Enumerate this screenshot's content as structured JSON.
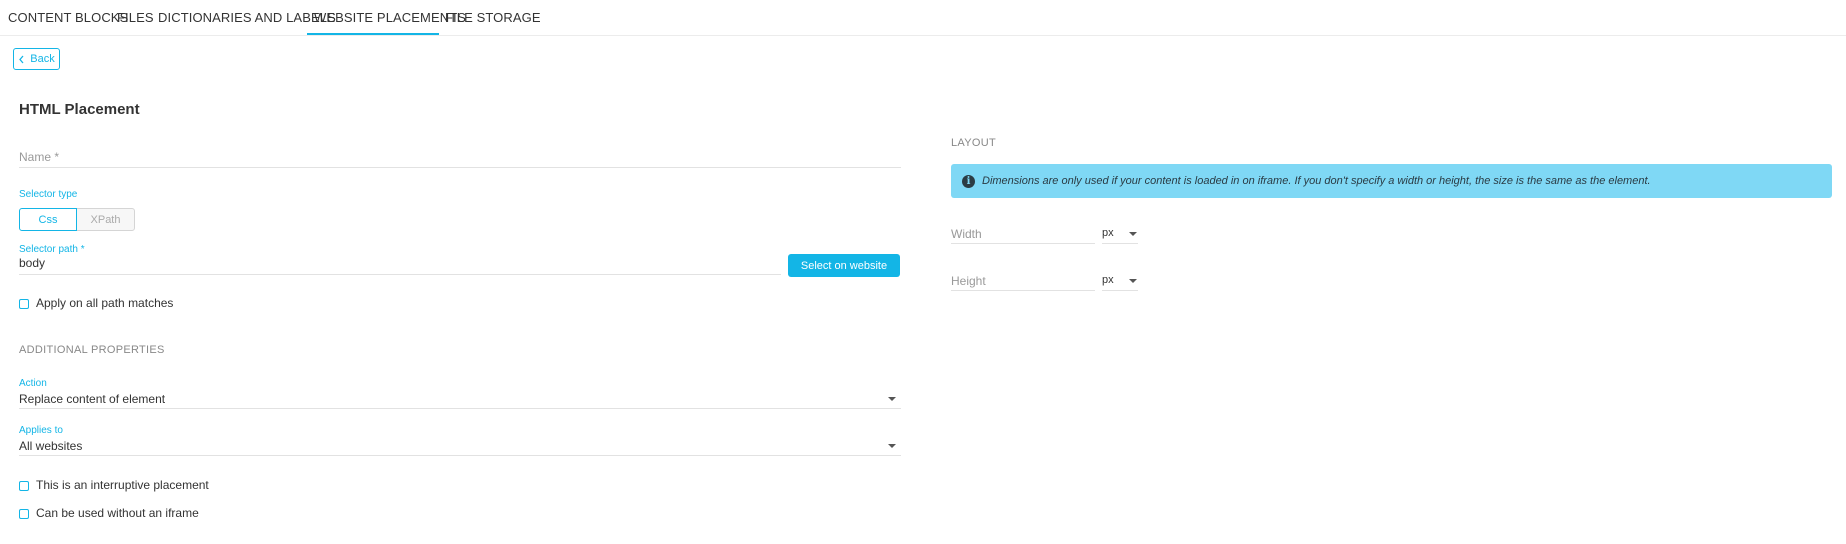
{
  "tabs": [
    {
      "label": "CONTENT BLOCKS",
      "active": false
    },
    {
      "label": "FILES",
      "active": false
    },
    {
      "label": "DICTIONARIES AND LABELS",
      "active": false
    },
    {
      "label": "WEBSITE PLACEMENTS",
      "active": true
    },
    {
      "label": "FILE STORAGE",
      "active": false
    }
  ],
  "back_label": "Back",
  "title": "HTML Placement",
  "form": {
    "name_label": "Name *",
    "name_value": "",
    "selector_type_label": "Selector type",
    "selector_options": [
      "Css",
      "XPath"
    ],
    "selector_selected": "Css",
    "selector_path_label": "Selector path *",
    "selector_path_value": "body",
    "select_on_website_label": "Select on website",
    "apply_all_label": "Apply on all path matches",
    "apply_all_checked": false
  },
  "additional": {
    "heading": "ADDITIONAL PROPERTIES",
    "action_label": "Action",
    "action_value": "Replace content of element",
    "applies_label": "Applies to",
    "applies_value": "All websites",
    "interruptive_label": "This is an interruptive placement",
    "interruptive_checked": false,
    "no_iframe_label": "Can be used without an iframe",
    "no_iframe_checked": false
  },
  "layout": {
    "heading": "LAYOUT",
    "info_text": "Dimensions are only used if your content is loaded in on iframe. If you don't specify a width or height, the size is the same as the element.",
    "info_icon": "info-icon",
    "width_label": "Width",
    "width_unit": "px",
    "height_label": "Height",
    "height_unit": "px"
  },
  "colors": {
    "accent": "#13b5e6",
    "info_bg": "#7fd8f5"
  }
}
